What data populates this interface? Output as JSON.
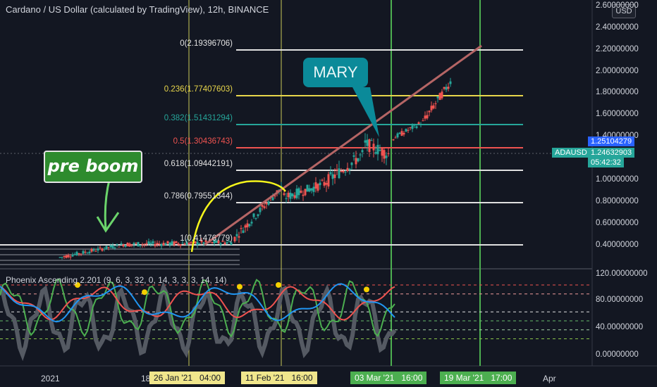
{
  "chart": {
    "title": "Cardano / US Dollar (calculated by TradingView), 12h, BINANCE",
    "currency_button": "USD",
    "price_axis_labels": [
      "2.60000000",
      "2.40000000",
      "2.20000000",
      "2.00000000",
      "1.80000000",
      "1.60000000",
      "1.40000000",
      "1.00000000",
      "0.80000000",
      "0.60000000",
      "0.40000000"
    ],
    "indicator_axis_labels": [
      "120.00000000",
      "80.00000000",
      "40.00000000",
      "0.00000000"
    ],
    "price_tag": "1.25104279",
    "symbol_tag": "ADAUSD",
    "last_price": "1.24632903",
    "countdown": "05:42:32",
    "indicator_title": "Phoenix Ascending 2.201 (9, 6, 3, 32, 0, 14, 3, 3, 3, 14, 14)",
    "time_axis": {
      "label_2021": "2021",
      "label_18": "18",
      "date1": "26 Jan '21",
      "time1": "04:00",
      "date2": "11 Feb '21",
      "time2": "16:00",
      "date3": "03 Mar '21",
      "time3": "16:00",
      "date4": "19 Mar '21",
      "time4": "17:00",
      "label_apr": "Apr"
    },
    "fib_levels": [
      {
        "label": "0(2.19396706)",
        "color": "#e0e0e0"
      },
      {
        "label": "0.236(1.77407603)",
        "color": "#e8d64b"
      },
      {
        "label": "0.382(1.51431294)",
        "color": "#26a69a"
      },
      {
        "label": "0.5(1.30436743)",
        "color": "#ef5350"
      },
      {
        "label": "0.618(1.09442191)",
        "color": "#e0e0e0"
      },
      {
        "label": "0.786(0.79551344)",
        "color": "#e0e0e0"
      },
      {
        "label": "1(0.41476779)",
        "color": "#e0e0e0"
      }
    ],
    "annotations": {
      "mary": "MARY",
      "pre_boom": "pre boom"
    },
    "colors": {
      "background": "#131722",
      "up_candle": "#26a69a",
      "down_candle": "#ef5350",
      "trendline": "#b56565",
      "arc": "#f5f51b",
      "green_vertical": "#4caf50",
      "yellow_vertical": "#c8c858"
    }
  }
}
